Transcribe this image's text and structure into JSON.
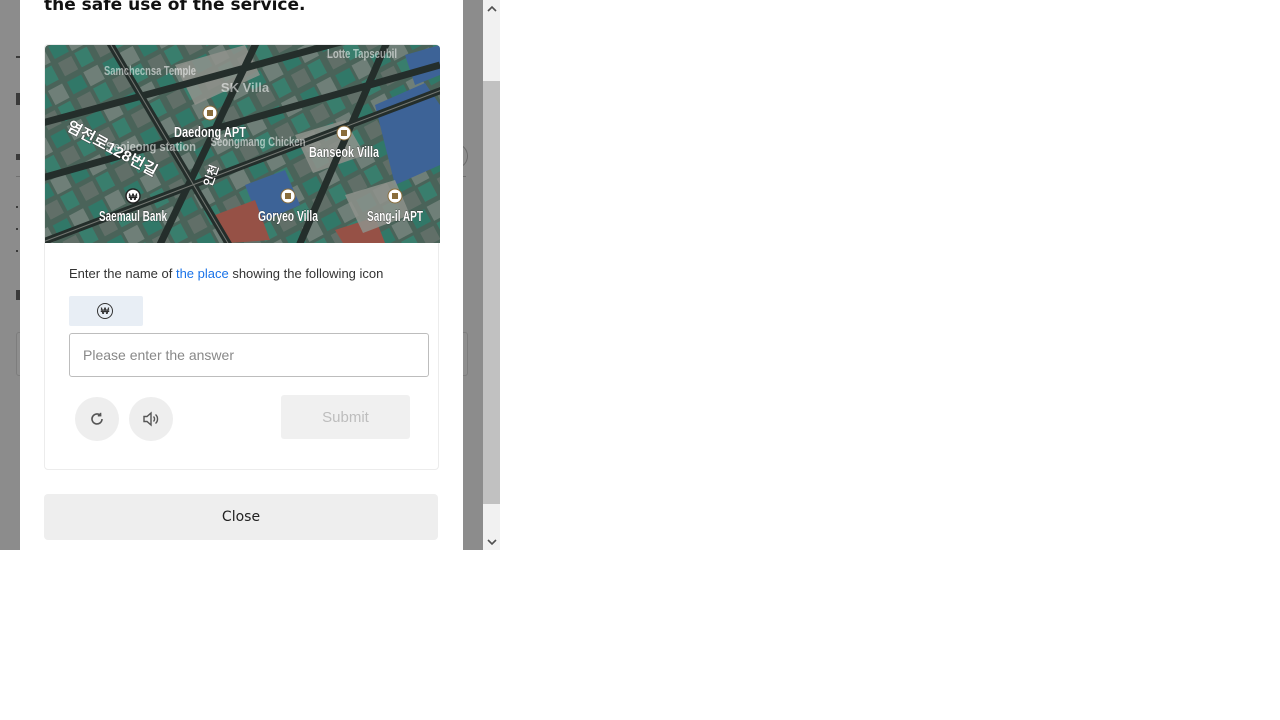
{
  "modal": {
    "title": "the safe use of the service.",
    "map_labels": {
      "temple": "Samchecnsa Temple",
      "sk_villa": "SK Villa",
      "lotte": "Lotte Tapseubil",
      "daedong": "Daedong APT",
      "chicken": "Seongmang Chicken",
      "banseok": "Banseok Villa",
      "seojeong": "Seojeong station",
      "road": "염전로128번길",
      "side_road": "인천",
      "saemaul": "Saemaul Bank",
      "goryeo": "Goryeo Villa",
      "sangil": "Sang-il APT"
    },
    "prompt_before": "Enter the name of ",
    "prompt_link": "the place",
    "prompt_after": " showing the following icon",
    "icon_glyph": "₩",
    "answer_placeholder": "Please enter the answer",
    "refresh_icon": "refresh-icon",
    "audio_icon": "speaker-icon",
    "submit_label": "Submit",
    "close_label": "Close"
  },
  "scrollbar": {
    "up_arrow": "▲",
    "down_arrow": "▼"
  }
}
